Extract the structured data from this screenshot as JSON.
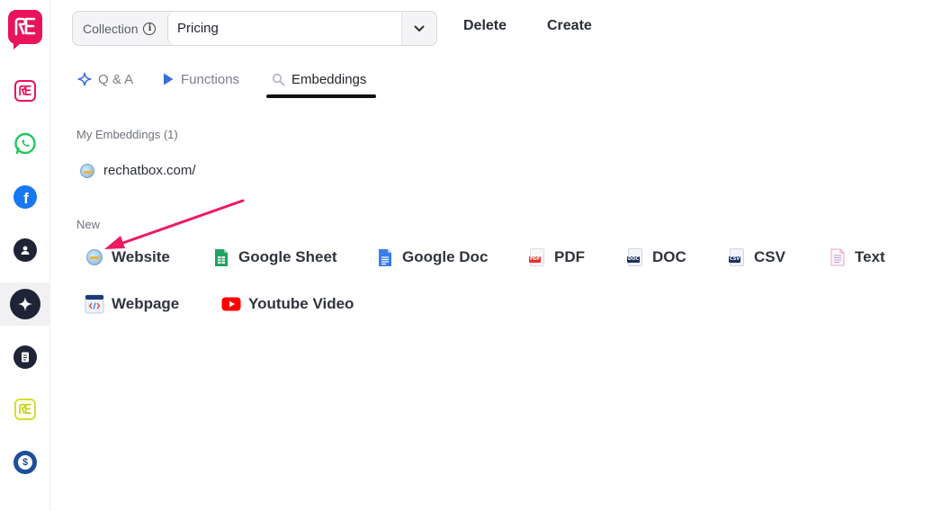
{
  "sidebar": {
    "logo_text": "RE",
    "items": [
      {
        "name": "rechatbox",
        "icon": "rechatbox-logo-icon"
      },
      {
        "name": "whatsapp",
        "icon": "whatsapp-icon"
      },
      {
        "name": "facebook",
        "icon": "facebook-icon"
      },
      {
        "name": "contacts",
        "icon": "contact-icon"
      },
      {
        "name": "ai",
        "icon": "sparkle-icon",
        "active": true
      },
      {
        "name": "notes",
        "icon": "document-icon"
      },
      {
        "name": "rechatbox-alt",
        "icon": "rechatbox-alt-logo-icon"
      },
      {
        "name": "billing",
        "icon": "dollar-icon"
      }
    ]
  },
  "toolbar": {
    "collection_label": "Collection",
    "collection_value": "Pricing",
    "delete_label": "Delete",
    "create_label": "Create"
  },
  "tabs": [
    {
      "label": "Q & A",
      "icon": "sparkle-icon"
    },
    {
      "label": "Functions",
      "icon": "play-icon"
    },
    {
      "label": "Embeddings",
      "icon": "search-icon",
      "active": true
    }
  ],
  "my_embeddings": {
    "title": "My Embeddings (1)",
    "items": [
      {
        "label": "rechatbox.com/",
        "icon": "globe-icon"
      }
    ]
  },
  "new_section": {
    "title": "New",
    "items": [
      {
        "label": "Website",
        "icon": "globe-icon"
      },
      {
        "label": "Google Sheet",
        "icon": "google-sheet-icon"
      },
      {
        "label": "Google Doc",
        "icon": "google-doc-icon"
      },
      {
        "label": "PDF",
        "icon": "pdf-file-icon"
      },
      {
        "label": "DOC",
        "icon": "doc-file-icon"
      },
      {
        "label": "CSV",
        "icon": "csv-file-icon"
      },
      {
        "label": "Text",
        "icon": "text-file-icon"
      },
      {
        "label": "Webpage",
        "icon": "webpage-code-icon"
      },
      {
        "label": "Youtube Video",
        "icon": "youtube-icon"
      }
    ]
  },
  "colors": {
    "brand": "#e8135b",
    "annotation_arrow": "#ec1a63",
    "active_tab_underline": "#111111"
  }
}
